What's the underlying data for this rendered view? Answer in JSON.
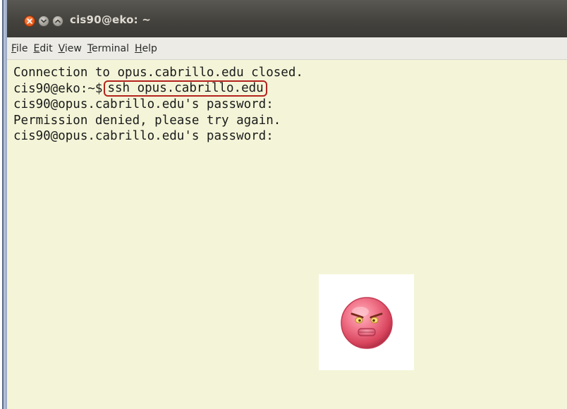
{
  "window": {
    "title": "cis90@eko: ~"
  },
  "menubar": {
    "items": [
      {
        "mnemonic": "F",
        "rest": "ile"
      },
      {
        "mnemonic": "E",
        "rest": "dit"
      },
      {
        "mnemonic": "V",
        "rest": "iew"
      },
      {
        "mnemonic": "T",
        "rest": "erminal"
      },
      {
        "mnemonic": "H",
        "rest": "elp"
      }
    ]
  },
  "terminal": {
    "line1": "Connection to opus.cabrillo.edu closed.",
    "prompt": "cis90@eko:~$",
    "command": "ssh opus.cabrillo.edu",
    "line3": "cis90@opus.cabrillo.edu's password:",
    "line4": "Permission denied, please try again.",
    "line5": "cis90@opus.cabrillo.edu's password:"
  },
  "colors": {
    "terminal_bg": "#f4f5d8",
    "highlight_border": "#b4231e",
    "titlebar": "#45433e"
  },
  "icons": {
    "close": "close-icon",
    "minimize": "minimize-icon",
    "maximize": "maximize-icon",
    "angry_face": "angry-face-icon"
  }
}
